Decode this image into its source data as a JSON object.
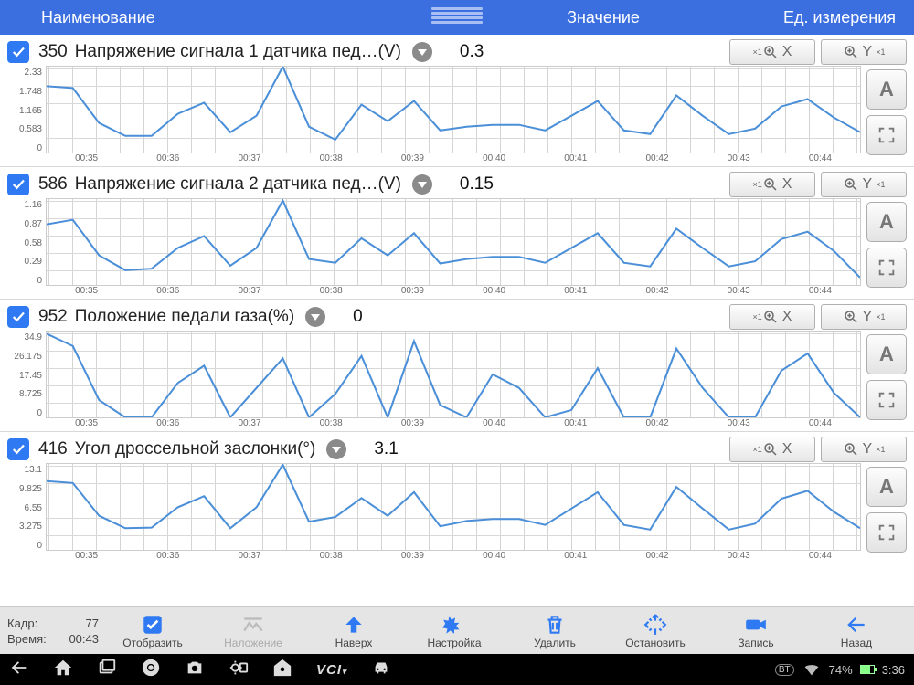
{
  "header": {
    "name": "Наименование",
    "value": "Значение",
    "unit": "Ед. измерения"
  },
  "params": [
    {
      "id": "350",
      "label": "Напряжение сигнала 1 датчика пед…(V)",
      "value": "0.3"
    },
    {
      "id": "586",
      "label": "Напряжение сигнала 2 датчика пед…(V)",
      "value": "0.15"
    },
    {
      "id": "952",
      "label": "Положение педали газа(%)",
      "value": "0"
    },
    {
      "id": "416",
      "label": "Угол дроссельной заслонки(°)",
      "value": "3.1"
    }
  ],
  "zoom": {
    "prefix": "×1",
    "x": "X",
    "y": "Y"
  },
  "sidebtn": {
    "auto": "A"
  },
  "xticks": [
    "00:35",
    "00:36",
    "00:37",
    "00:38",
    "00:39",
    "00:40",
    "00:41",
    "00:42",
    "00:43",
    "00:44"
  ],
  "chart_data": [
    {
      "type": "line",
      "title": "350",
      "yticks": [
        "2.33",
        "1.748",
        "1.165",
        "0.583",
        "0"
      ],
      "ylim": [
        0,
        2.33
      ],
      "x": [
        "00:35",
        "00:36",
        "00:37",
        "00:38",
        "00:39",
        "00:40",
        "00:41",
        "00:42",
        "00:43",
        "00:44"
      ],
      "values": [
        1.8,
        1.75,
        0.8,
        0.45,
        0.45,
        1.05,
        1.35,
        0.55,
        1.0,
        2.33,
        0.7,
        0.35,
        1.3,
        0.85,
        1.4,
        0.6,
        0.7,
        0.75,
        0.75,
        0.6,
        1.0,
        1.4,
        0.6,
        0.5,
        1.55,
        1.0,
        0.5,
        0.65,
        1.25,
        1.45,
        0.95,
        0.55
      ]
    },
    {
      "type": "line",
      "title": "586",
      "yticks": [
        "1.16",
        "0.87",
        "0.58",
        "0.29",
        "0"
      ],
      "ylim": [
        0,
        1.16
      ],
      "x": [
        "00:35",
        "00:36",
        "00:37",
        "00:38",
        "00:39",
        "00:40",
        "00:41",
        "00:42",
        "00:43",
        "00:44"
      ],
      "values": [
        0.82,
        0.88,
        0.4,
        0.2,
        0.22,
        0.5,
        0.66,
        0.26,
        0.5,
        1.14,
        0.35,
        0.3,
        0.63,
        0.4,
        0.7,
        0.29,
        0.35,
        0.38,
        0.38,
        0.3,
        0.5,
        0.7,
        0.3,
        0.25,
        0.76,
        0.5,
        0.25,
        0.32,
        0.62,
        0.72,
        0.46,
        0.1
      ]
    },
    {
      "type": "line",
      "title": "952",
      "yticks": [
        "34.9",
        "26.175",
        "17.45",
        "8.725",
        "0"
      ],
      "ylim": [
        0,
        34.9
      ],
      "x": [
        "00:35",
        "00:36",
        "00:37",
        "00:38",
        "00:39",
        "00:40",
        "00:41",
        "00:42",
        "00:43",
        "00:44"
      ],
      "values": [
        34,
        29,
        7,
        0,
        0,
        14,
        21,
        0,
        12,
        24,
        0,
        9.5,
        25,
        0,
        31,
        5,
        0,
        17.5,
        12,
        0,
        3,
        20,
        0,
        0,
        28,
        12,
        0,
        0,
        19,
        26,
        10,
        0
      ]
    },
    {
      "type": "line",
      "title": "416",
      "yticks": [
        "13.1",
        "9.825",
        "6.55",
        "3.275",
        "0"
      ],
      "ylim": [
        0,
        13.1
      ],
      "x": [
        "00:35",
        "00:36",
        "00:37",
        "00:38",
        "00:39",
        "00:40",
        "00:41",
        "00:42",
        "00:43",
        "00:44"
      ],
      "values": [
        10.5,
        10.2,
        5.2,
        3.3,
        3.4,
        6.5,
        8.2,
        3.3,
        6.5,
        13.0,
        4.3,
        5.0,
        7.9,
        5.2,
        8.8,
        3.6,
        4.4,
        4.7,
        4.7,
        3.8,
        6.3,
        8.8,
        3.8,
        3.1,
        9.6,
        6.3,
        3.1,
        4.0,
        7.8,
        9.0,
        5.8,
        3.3
      ]
    }
  ],
  "footer": {
    "frame_lbl": "Кадр:",
    "frame_val": "77",
    "time_lbl": "Время:",
    "time_val": "00:43",
    "items": [
      {
        "label": "Отобразить",
        "key": "show"
      },
      {
        "label": "Наложение",
        "key": "overlay"
      },
      {
        "label": "Наверх",
        "key": "top"
      },
      {
        "label": "Настройка",
        "key": "settings"
      },
      {
        "label": "Удалить",
        "key": "delete"
      },
      {
        "label": "Остановить",
        "key": "stop"
      },
      {
        "label": "Запись",
        "key": "record"
      },
      {
        "label": "Назад",
        "key": "back"
      }
    ]
  },
  "statusbar": {
    "bt": "BT",
    "batt": "74%",
    "clock": "3:36"
  }
}
